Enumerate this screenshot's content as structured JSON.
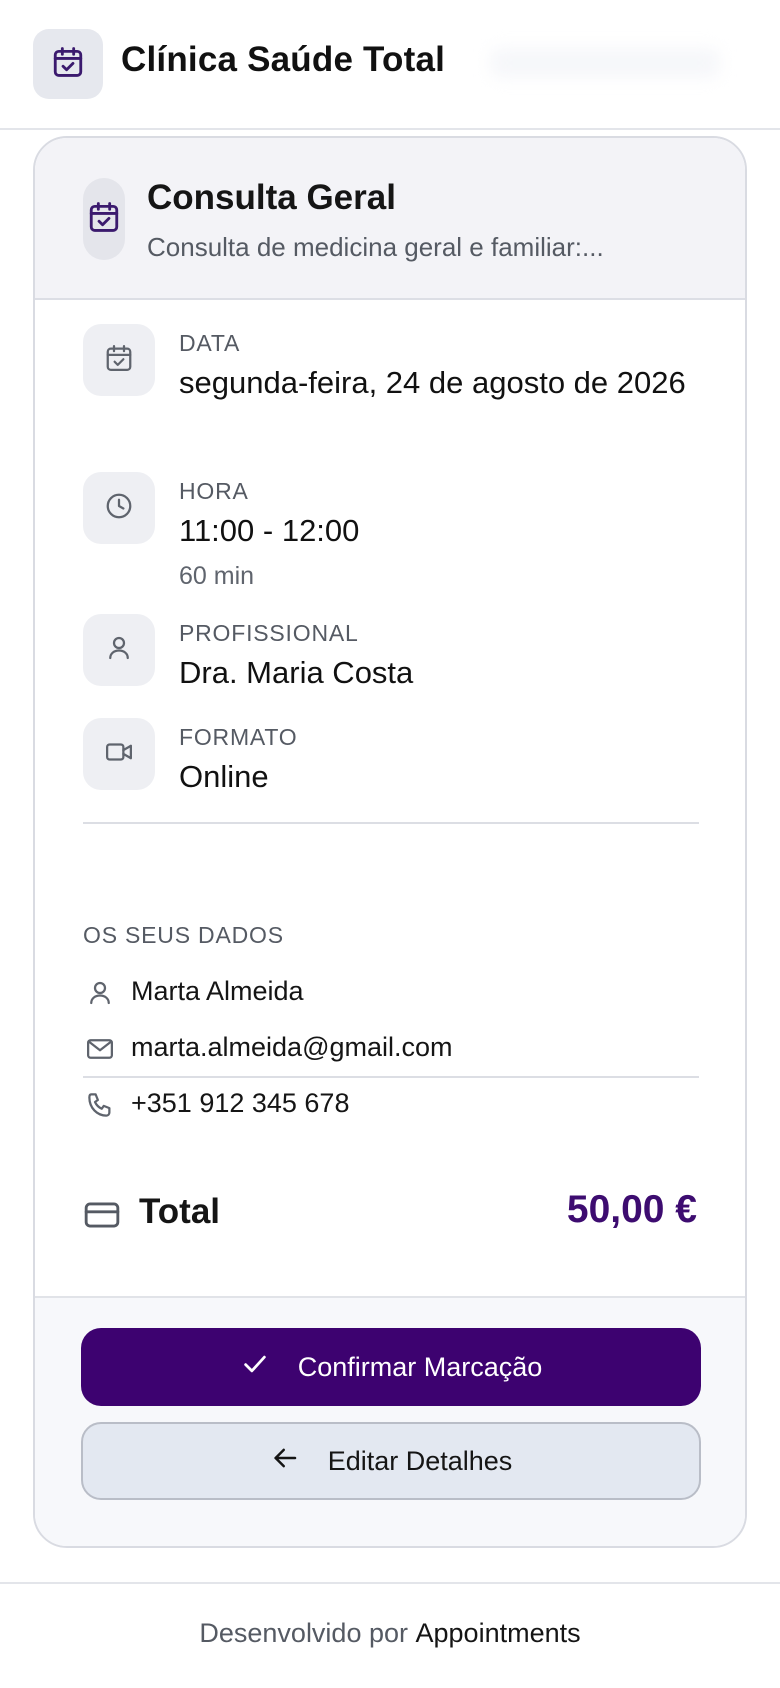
{
  "header": {
    "logo_icon": "calendar-check-icon",
    "title": "Clínica Saúde Total"
  },
  "service": {
    "icon": "calendar-check-icon",
    "title": "Consulta Geral",
    "description": "Consulta de medicina geral e familiar:..."
  },
  "details": {
    "date": {
      "icon": "calendar-check-icon",
      "label": "DATA",
      "value": "segunda-feira, 24 de agosto de 2026"
    },
    "time": {
      "icon": "clock-icon",
      "label": "HORA",
      "value": "11:00 - 12:00",
      "duration": "60 min"
    },
    "professional": {
      "icon": "user-icon",
      "label": "PROFISSIONAL",
      "value": "Dra. Maria Costa"
    },
    "format": {
      "icon": "video-icon",
      "label": "FORMATO",
      "value": "Online"
    }
  },
  "customer": {
    "section_label": "OS SEUS DADOS",
    "name": "Marta Almeida",
    "email": "marta.almeida@gmail.com",
    "phone": "+351 912 345 678"
  },
  "total": {
    "icon": "credit-card-icon",
    "label": "Total",
    "value": "50,00 €"
  },
  "actions": {
    "confirm_label": "Confirmar Marcação",
    "edit_label": "Editar Detalhes"
  },
  "footer": {
    "prefix": "Desenvolvido por",
    "brand": "Appointments"
  },
  "colors": {
    "accent": "#3d0270",
    "accent_icon": "#3b1a6e",
    "price": "#3d0c70"
  }
}
